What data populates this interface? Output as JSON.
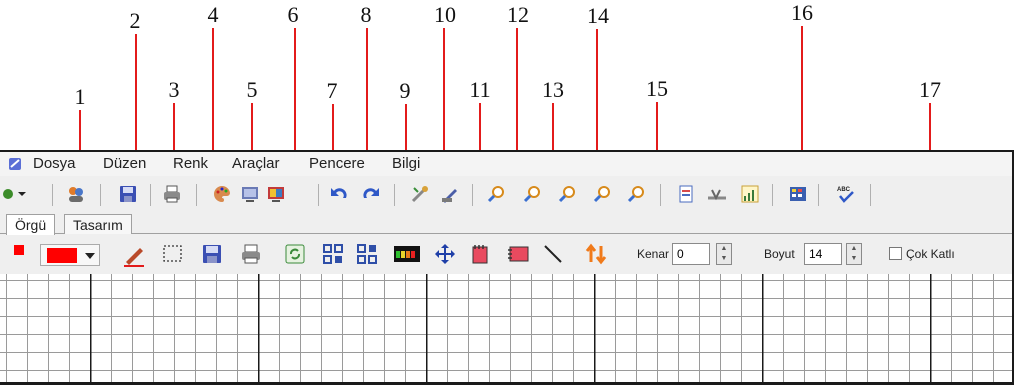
{
  "callouts": [
    "1",
    "2",
    "3",
    "4",
    "5",
    "6",
    "7",
    "8",
    "9",
    "10",
    "11",
    "12",
    "13",
    "14",
    "15",
    "16",
    "17"
  ],
  "menu": [
    "Dosya",
    "Düzen",
    "Renk",
    "Araçlar",
    "Pencere",
    "Bilgi"
  ],
  "tabs": [
    "Örgü",
    "Tasarım"
  ],
  "fields": {
    "kenar_label": "Kenar",
    "kenar_value": "0",
    "boyut_label": "Boyut",
    "boyut_value": "14",
    "cok_katli_label": "Çok Katlı"
  },
  "colors": {
    "arrow": "#e31b1b",
    "swatch_red": "#ff0000"
  }
}
